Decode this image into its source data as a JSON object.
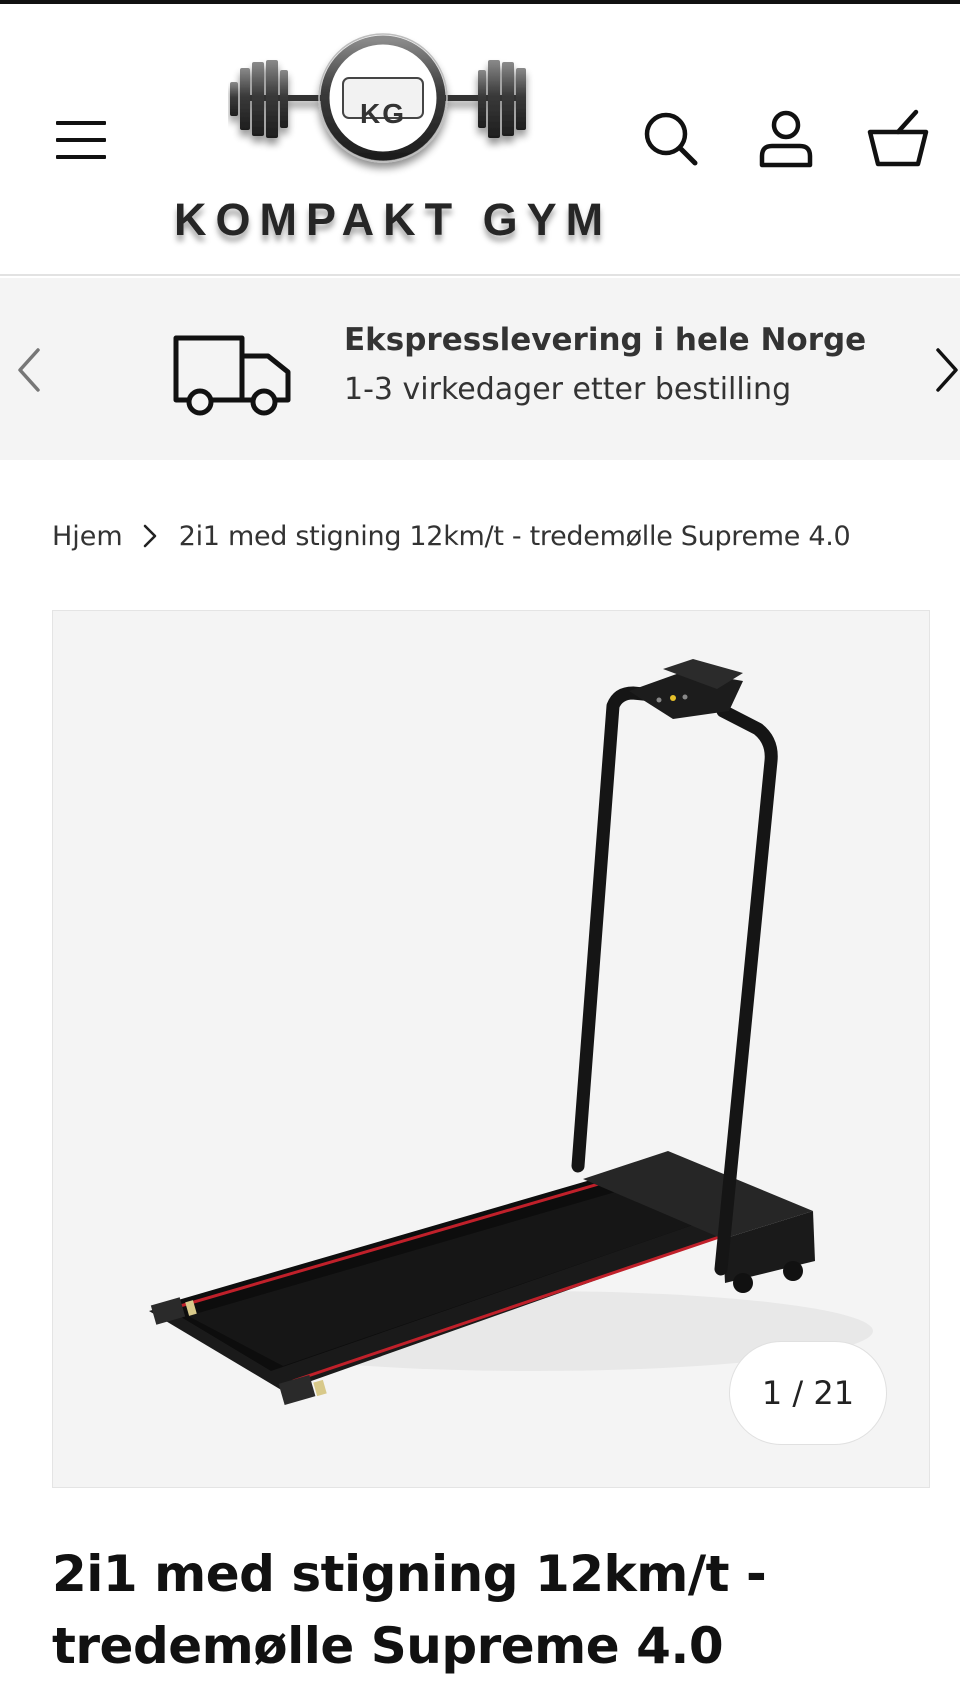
{
  "header": {
    "logo_monogram": "KG",
    "brand_name": "KOMPAKT GYM",
    "icons": [
      "menu-icon",
      "search-icon",
      "account-icon",
      "cart-icon"
    ]
  },
  "announcement": {
    "title": "Ekspresslevering i hele Norge",
    "subtitle": "1-3 virkedager etter bestilling",
    "icon": "truck-icon"
  },
  "breadcrumb": {
    "home": "Hjem",
    "current": "2i1 med stigning 12km/t - tredemølle Supreme 4.0"
  },
  "gallery": {
    "counter": "1 / 21"
  },
  "product": {
    "title": "2i1 med stigning 12km/t - tredemølle Supreme 4.0"
  },
  "colors": {
    "text": "#1b1b1b",
    "bar_background": "#f4f4f4",
    "accent_red": "#c0202a"
  }
}
